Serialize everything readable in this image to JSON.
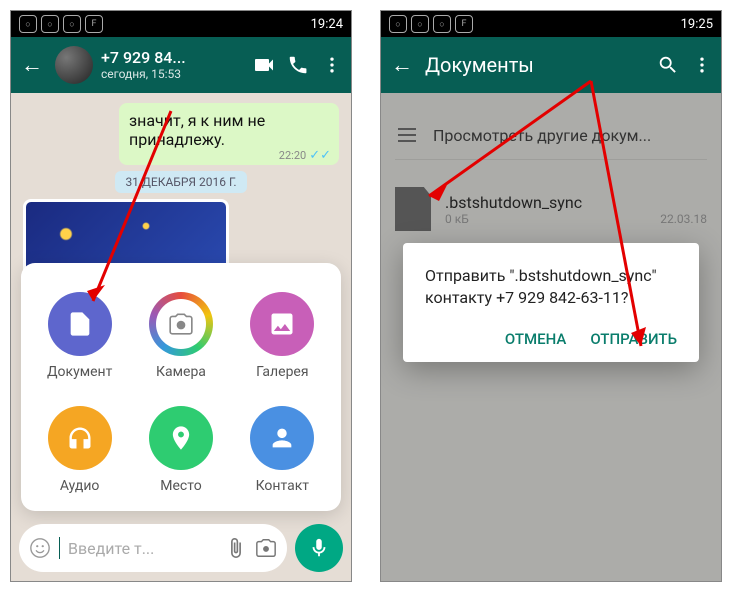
{
  "phone1": {
    "status_time": "19:24",
    "contact_name": "+7 929 84...",
    "contact_sub": "сегодня, 15:53",
    "msg_out": "значит, я к ним не принадлежу.",
    "msg_time": "22:20",
    "date_pill": "31 ДЕКАБРЯ 2016 Г.",
    "attach": {
      "document": "Документ",
      "camera": "Камера",
      "gallery": "Галерея",
      "audio": "Аудио",
      "location": "Место",
      "contact": "Контакт"
    },
    "input_placeholder": "Введите т..."
  },
  "phone2": {
    "status_time": "19:25",
    "title": "Документы",
    "browse_label": "Просмотреть другие докум...",
    "file": {
      "name": ".bstshutdown_sync",
      "size": "0 кБ",
      "date": "22.03.18"
    },
    "dialog_text": "Отправить \".bstshutdown_sync\" контакту +7 929 842-63-11?",
    "cancel": "ОТМЕНА",
    "send": "ОТПРАВИТЬ"
  }
}
